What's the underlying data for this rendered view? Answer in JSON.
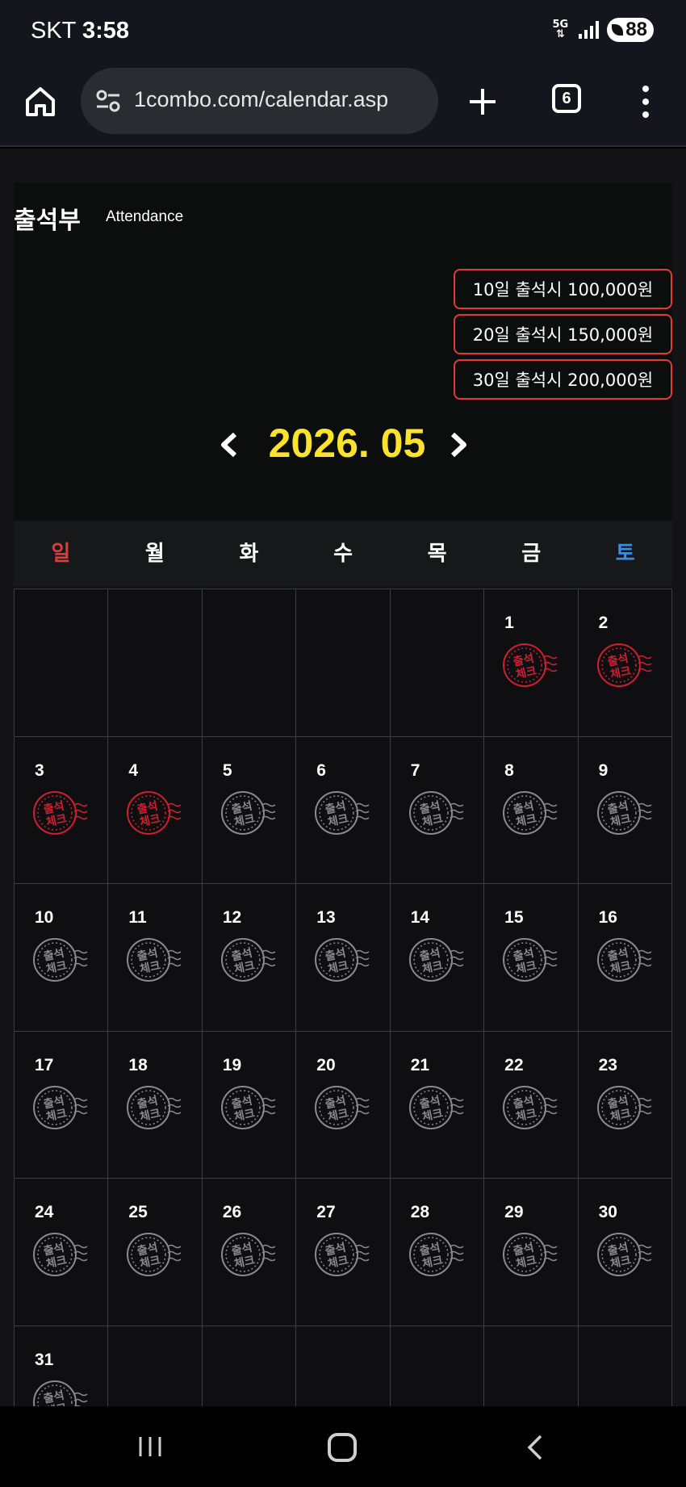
{
  "status": {
    "carrier": "SKT",
    "time": "3:58",
    "network": "5G",
    "battery": "88"
  },
  "browser": {
    "url": "1combo.com/calendar.asp",
    "tab_count": "6"
  },
  "attendance": {
    "title": "출석부",
    "subtitle": "Attendance",
    "rewards": [
      "10일 출석시 100,000원",
      "20일 출석시 150,000원",
      "30일 출석시 200,000원"
    ],
    "month": "2026. 05"
  },
  "weekdays": [
    "일",
    "월",
    "화",
    "수",
    "목",
    "금",
    "토"
  ],
  "calendar": {
    "leading_blanks": 5,
    "days_in_month": 31,
    "checked_days": [
      1,
      2,
      3,
      4
    ],
    "stamp_text": [
      "출석",
      "체크"
    ]
  },
  "colors": {
    "accent_yellow": "#fbe22d",
    "stamp_checked": "#d01d32",
    "stamp_unchecked": "#8a8a8a",
    "sunday": "#e53a34",
    "saturday": "#3a8ee6",
    "reward_border": "#e53a34"
  }
}
